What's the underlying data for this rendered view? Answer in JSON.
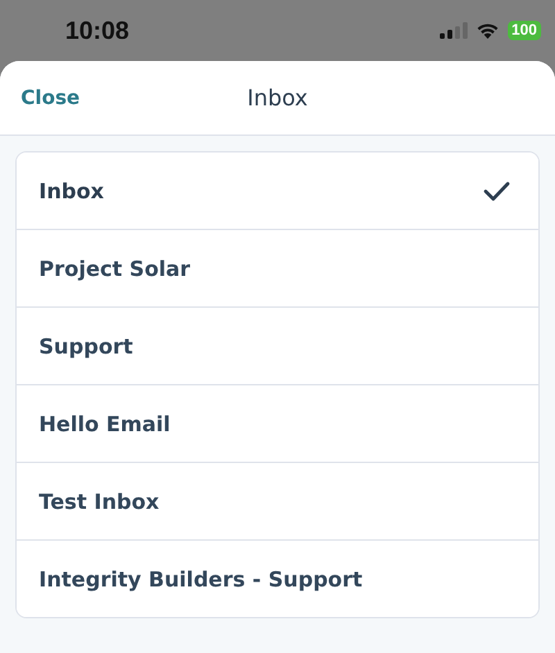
{
  "status_bar": {
    "time": "10:08",
    "battery": "100"
  },
  "header": {
    "close": "Close",
    "title": "Inbox"
  },
  "inboxes": [
    {
      "label": "Inbox",
      "selected": true
    },
    {
      "label": "Project Solar",
      "selected": false
    },
    {
      "label": "Support",
      "selected": false
    },
    {
      "label": "Hello Email",
      "selected": false
    },
    {
      "label": "Test Inbox",
      "selected": false
    },
    {
      "label": "Integrity Builders - Support",
      "selected": false
    }
  ]
}
